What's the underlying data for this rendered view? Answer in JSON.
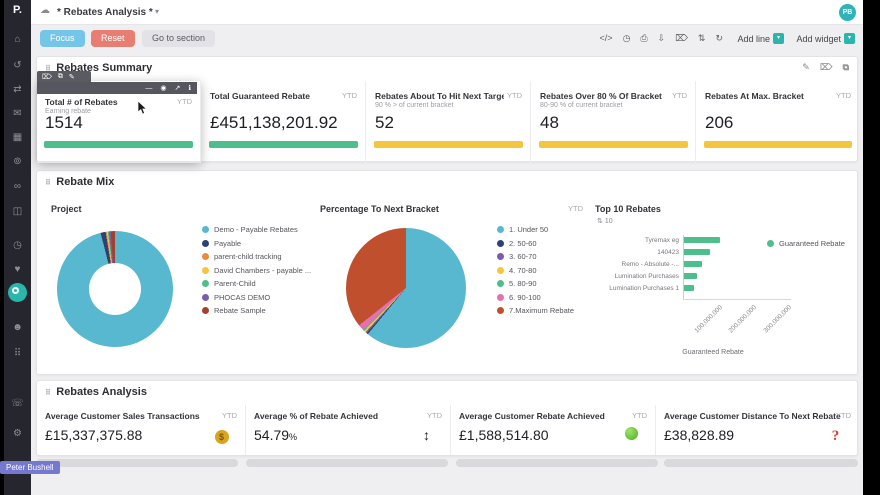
{
  "app": {
    "title": "* Rebates Analysis *",
    "avatar": "PB"
  },
  "toolbar": {
    "focus": "Focus",
    "reset": "Reset",
    "goto_section": "Go to section",
    "add_line": "Add line",
    "add_widget": "Add widget"
  },
  "icons": {
    "logo": "P.",
    "cloud": "☁",
    "chevron": "▾",
    "code": "</>",
    "clock": "◷",
    "print": "⎙",
    "download": "⇩",
    "trash": "⌦",
    "swap": "⇅",
    "refresh": "↻",
    "edit": "✎",
    "copy": "⧉",
    "minimize": "—",
    "camera": "◉",
    "share": "↗",
    "info": "ℹ",
    "drag": "⠿",
    "home": "⌂",
    "history": "↺",
    "transfer": "⇄",
    "messages": "✉",
    "grid": "▦",
    "records": "⊚",
    "sync": "∞",
    "team": "◫",
    "recent": "◷",
    "favorites": "♥",
    "profile": "☻",
    "apps": "⠿",
    "support": "☏",
    "settings": "⚙",
    "money": "$",
    "updown": "↕",
    "question": "?",
    "sort": "⇅"
  },
  "summary": {
    "title": "Rebates Summary",
    "cards": [
      {
        "title": "Total # of Rebates",
        "subtitle": "Earning rebate",
        "period": "YTD",
        "value": "1514",
        "bar": "#4dbe8c"
      },
      {
        "title": "Total Guaranteed Rebate",
        "subtitle": "",
        "period": "YTD",
        "value": "£451,138,201.92",
        "bar": "#4dbe8c"
      },
      {
        "title": "Rebates About To Hit Next Target",
        "subtitle": "90 % > of current bracket",
        "period": "YTD",
        "value": "52",
        "bar": "#f3c63f"
      },
      {
        "title": "Rebates Over 80 % Of Bracket",
        "subtitle": "80-90 % of current bracket",
        "period": "YTD",
        "value": "48",
        "bar": "#f3c63f"
      },
      {
        "title": "Rebates At Max. Bracket",
        "subtitle": "",
        "period": "YTD",
        "value": "206",
        "bar": "#f3c63f"
      }
    ]
  },
  "mix": {
    "title": "Rebate Mix",
    "panels": {
      "project": {
        "title": "Project"
      },
      "bracket": {
        "title": "Percentage To Next Bracket",
        "period": "YTD"
      },
      "top10": {
        "title": "Top 10 Rebates",
        "filter": "10"
      }
    }
  },
  "analysis": {
    "title": "Rebates Analysis",
    "cards": [
      {
        "title": "Average Customer Sales Transactions",
        "period": "YTD",
        "value": "£15,337,375.88"
      },
      {
        "title": "Average % of Rebate Achieved",
        "period": "YTD",
        "value": "54.79",
        "suffix": "%"
      },
      {
        "title": "Average Customer Rebate Achieved",
        "period": "YTD",
        "value": "£1,588,514.80"
      },
      {
        "title": "Average Customer Distance To Next Rebate",
        "period": "YTD",
        "value": "£38,828.89"
      }
    ]
  },
  "chart_data": [
    {
      "type": "pie",
      "variant": "donut",
      "title": "Project",
      "labels": [
        "Demo - Payable Rebates",
        "Payable",
        "parent-child tracking",
        "David Chambers - payable ...",
        "Parent-Child",
        "PHOCAS DEMO",
        "Rebate Sample"
      ],
      "values": [
        96.0,
        1.4,
        0.3,
        0.3,
        0.3,
        0.5,
        1.2
      ],
      "colors": [
        "#57b8cf",
        "#2e4172",
        "#ee8a3d",
        "#f3c63f",
        "#4dbe8c",
        "#7a5ca8",
        "#a63f2c"
      ],
      "legend_position": "right"
    },
    {
      "type": "pie",
      "title": "Percentage To Next Bracket",
      "period": "YTD",
      "labels": [
        "1. Under 50",
        "2. 50-60",
        "3. 60-70",
        "4. 70-80",
        "5. 80-90",
        "6. 90-100",
        "7.Maximum Rebate"
      ],
      "values": [
        61,
        0.4,
        0.4,
        0.5,
        0.4,
        1.6,
        35.7
      ],
      "colors": [
        "#57b8cf",
        "#2e4172",
        "#7a5ca8",
        "#f3c63f",
        "#4dbe8c",
        "#e66fb2",
        "#bf4f2d"
      ],
      "legend_position": "right"
    },
    {
      "type": "bar",
      "orientation": "horizontal",
      "title": "Top 10 Rebates",
      "categories": [
        "Tyremax eg",
        "140423",
        "Remo - Absolute -...",
        "Lumination Purchases",
        "Lumination Purchases 1"
      ],
      "values": [
        105000000,
        76000000,
        52000000,
        38000000,
        30000000
      ],
      "xmax": 300000000,
      "x_ticks": [
        "100,000,000",
        "200,000,000",
        "300,000,000"
      ],
      "xlabel": "Guaranteed Rebate",
      "legend": [
        {
          "label": "Guaranteed Rebate",
          "color": "#4dbe8c"
        }
      ]
    }
  ],
  "tooltip": "Peter Bushell"
}
